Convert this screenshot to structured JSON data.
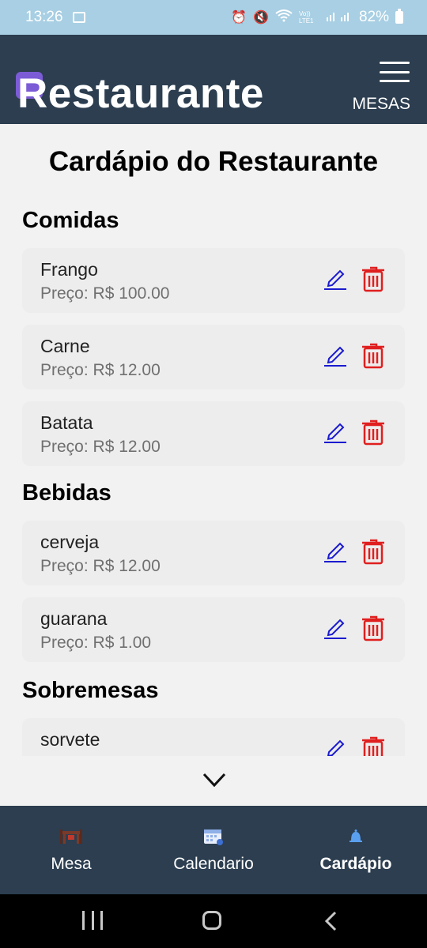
{
  "status_bar": {
    "time": "13:26",
    "network_label": "Vo)) LTE1",
    "battery": "82%"
  },
  "header": {
    "brand": "Restaurante",
    "nav_link": "MESAS",
    "menu_icon": "hamburger-menu-icon"
  },
  "page": {
    "title": "Cardápio do Restaurante"
  },
  "sections": {
    "comidas": {
      "title": "Comidas",
      "items": [
        {
          "name": "Frango",
          "price": "Preço: R$ 100.00"
        },
        {
          "name": "Carne",
          "price": "Preço: R$ 12.00"
        },
        {
          "name": "Batata",
          "price": "Preço: R$ 12.00"
        }
      ]
    },
    "bebidas": {
      "title": "Bebidas",
      "items": [
        {
          "name": "cerveja",
          "price": "Preço: R$ 12.00"
        },
        {
          "name": "guarana",
          "price": "Preço: R$ 1.00"
        }
      ]
    },
    "sobremesas": {
      "title": "Sobremesas",
      "items": [
        {
          "name": "sorvete",
          "price": ""
        }
      ]
    }
  },
  "icons": {
    "edit": "pencil-icon",
    "delete": "trash-icon",
    "scroll": "chevron-down-icon"
  },
  "tabs": [
    {
      "label": "Mesa",
      "icon": "table-icon",
      "active": false
    },
    {
      "label": "Calendario",
      "icon": "calendar-icon",
      "active": false
    },
    {
      "label": "Cardápio",
      "icon": "bell-icon",
      "active": true
    }
  ],
  "colors": {
    "header_bg": "#2c3e50",
    "status_bar_bg": "#a8cfe3",
    "edit_icon": "#1a1ad0",
    "delete_icon": "#e01f1f",
    "logo_accent": "#7c5cd6",
    "calendar_icon": "#8fb0e8",
    "bell_icon": "#5aa0f0"
  }
}
